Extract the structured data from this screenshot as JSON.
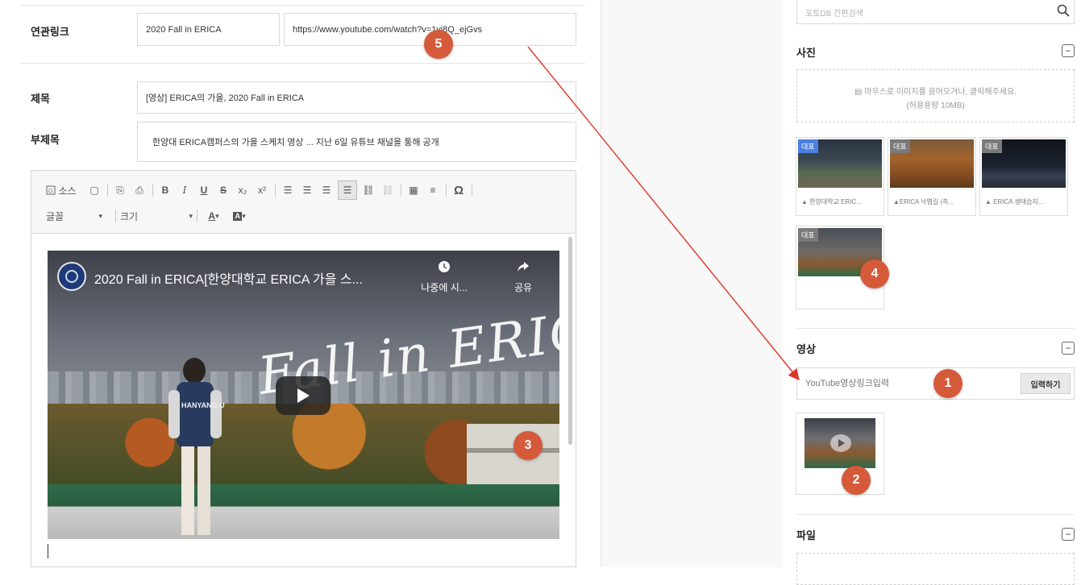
{
  "form": {
    "related_link": {
      "label": "연관링크",
      "name_value": "2020 Fall in ERICA",
      "url_value": "https://www.youtube.com/watch?v=1yi8Q_ejGvs"
    },
    "title": {
      "label": "제목",
      "value": "[영상] ERICA의 가을, 2020 Fall in ERICA"
    },
    "subtitle": {
      "label": "부제목",
      "value": "한양대 ERICA캠퍼스의 가을 스케치 영상 ... 지난 6일 유튜브 채널을 통해 공개"
    }
  },
  "editor": {
    "toolbar_row1": [
      "소스",
      "B",
      "I",
      "U",
      "S",
      "x₂",
      "x²",
      "Ω"
    ],
    "source_label": "소스",
    "font_label": "글꼴",
    "size_label": "크기"
  },
  "video": {
    "title": "2020 Fall in ERICA[한양대학교 ERICA 가을 스...",
    "watch_later": "나중에 시...",
    "share": "공유",
    "overlay_text": "Fall in ERICA",
    "jacket_text": "HANYANG UNIV"
  },
  "sidebar": {
    "photo_search_placeholder": "포토DB 간편검색",
    "photo_section": {
      "title": "사진",
      "dropzone_line1": "마우스로 이미지를 끌어오거나, 클릭해주세요.",
      "dropzone_line2": "(허용용량 10MB)",
      "badge": "대표",
      "thumbs": [
        {
          "caption": "▲ 한양대학교 ERIC..."
        },
        {
          "caption": "▲ERICA 낙엽길 (측..."
        },
        {
          "caption": "▲ ERICA 생태습지..."
        },
        {
          "caption": ""
        }
      ]
    },
    "video_section": {
      "title": "영상",
      "input_placeholder": "YouTube영상링크입력",
      "submit_label": "입력하기"
    },
    "file_section": {
      "title": "파일"
    }
  },
  "callouts": [
    "1",
    "2",
    "3",
    "4",
    "5"
  ],
  "colors": {
    "callout": "#d45a3a",
    "badge_blue": "#4a7fe0",
    "badge_gray": "#7a7a7a",
    "arrow": "#e0352b"
  }
}
